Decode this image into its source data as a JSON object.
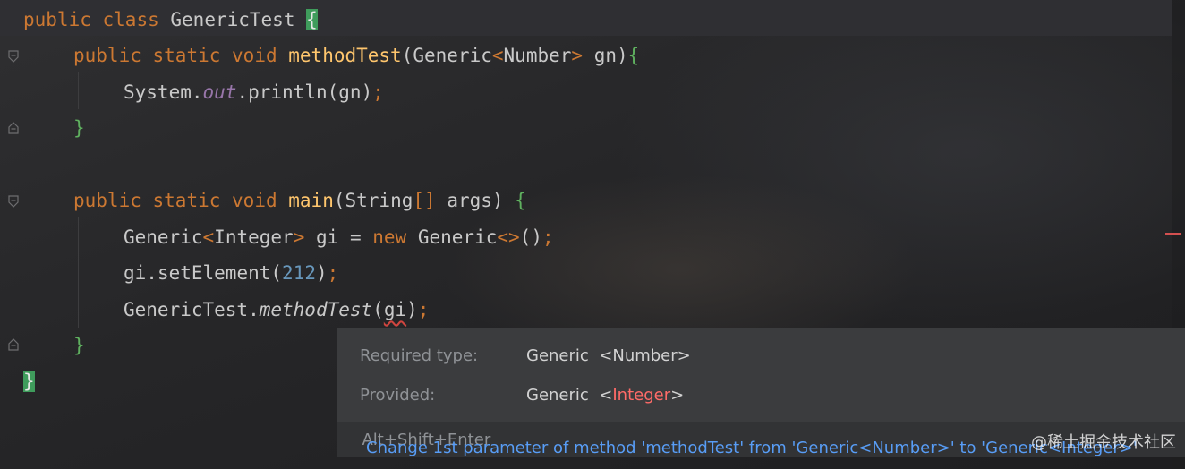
{
  "editor": {
    "lines": [
      {
        "k1": "public",
        "k2": "class",
        "name": "GenericTest",
        "brace": "{"
      },
      {
        "k1": "public",
        "k2": "static",
        "k3": "void",
        "fn": "methodTest",
        "open": "(",
        "type": "Generic",
        "lt": "<",
        "param_type": "Number",
        "gt": ">",
        "arg": "gn",
        "close": ")",
        "brace": "{"
      },
      {
        "cls": "System",
        "dot1": ".",
        "field": "out",
        "dot2": ".",
        "call": "println",
        "open": "(",
        "arg": "gn",
        "close": ")",
        "semi": ";"
      },
      {
        "brace": "}"
      },
      {
        "k1": "public",
        "k2": "static",
        "k3": "void",
        "fn": "main",
        "open": "(",
        "type": "String",
        "arr": "[]",
        "arg": "args",
        "close": ")",
        "brace": "{"
      },
      {
        "type": "Generic",
        "lt": "<",
        "param_type": "Integer",
        "gt": ">",
        "var": "gi",
        "eq": "=",
        "new_kw": "new",
        "ctor": "Generic",
        "diamond": "<>",
        "call": "()",
        "semi": ";"
      },
      {
        "obj": "gi",
        "dot": ".",
        "call": "setElement",
        "open": "(",
        "num": "212",
        "close": ")",
        "semi": ";"
      },
      {
        "cls": "GenericTest",
        "dot": ".",
        "call": "methodTest",
        "open": "(",
        "arg": "gi",
        "close": ")",
        "semi": ";"
      },
      {
        "brace": "}"
      },
      {
        "brace": "}"
      }
    ]
  },
  "popup": {
    "required_label": "Required type:",
    "required_type": "Generic",
    "required_param": "<Number>",
    "provided_label": "Provided:",
    "provided_type": "Generic",
    "provided_lt": "<",
    "provided_param": "Integer",
    "provided_gt": ">",
    "quickfix": "Change 1st parameter of method 'methodTest' from 'Generic<Number>' to 'Generic<Integer>'",
    "shortcut": "Alt+Shift+Enter"
  },
  "watermark": "@稀土掘金技术社区"
}
